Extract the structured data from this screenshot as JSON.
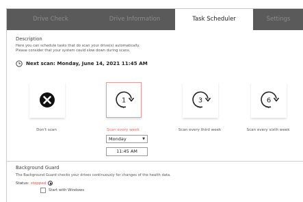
{
  "tabs": [
    {
      "label": "Drive Check",
      "active": false
    },
    {
      "label": "Drive Information",
      "active": false
    },
    {
      "label": "Task Scheduler",
      "active": true
    },
    {
      "label": "Settings",
      "active": false
    }
  ],
  "description": {
    "title": "Description",
    "line1": "Here you can schedule tasks that do scan your drive(s) automatically.",
    "line2": "Please consider that your system could slow down during scans.",
    "next_scan": "Next scan: Monday, June 14, 2021 11:45 AM"
  },
  "options": [
    {
      "label": "Don't scan",
      "icon": "x-icon",
      "selected": false
    },
    {
      "label": "Scan every week",
      "icon": "repeat-1-icon",
      "digit": "1",
      "selected": true
    },
    {
      "label": "Scan every third week",
      "icon": "repeat-3-icon",
      "digit": "3",
      "selected": false
    },
    {
      "label": "Scan every sixth week",
      "icon": "repeat-6-icon",
      "digit": "6",
      "selected": false
    }
  ],
  "schedule": {
    "day": "Monday",
    "time": "11:45 AM"
  },
  "background_guard": {
    "title": "Background Guard",
    "description": "The Background Guard checks your drives continuously for changes of the health data.",
    "status_label": "Status:",
    "status_value": "stopped",
    "start_with_windows": "Start with Windows",
    "start_with_windows_checked": false
  },
  "colors": {
    "tab_bar": "#5a5a5a",
    "accent": "#e96a6a",
    "selected_border": "#e89896"
  }
}
